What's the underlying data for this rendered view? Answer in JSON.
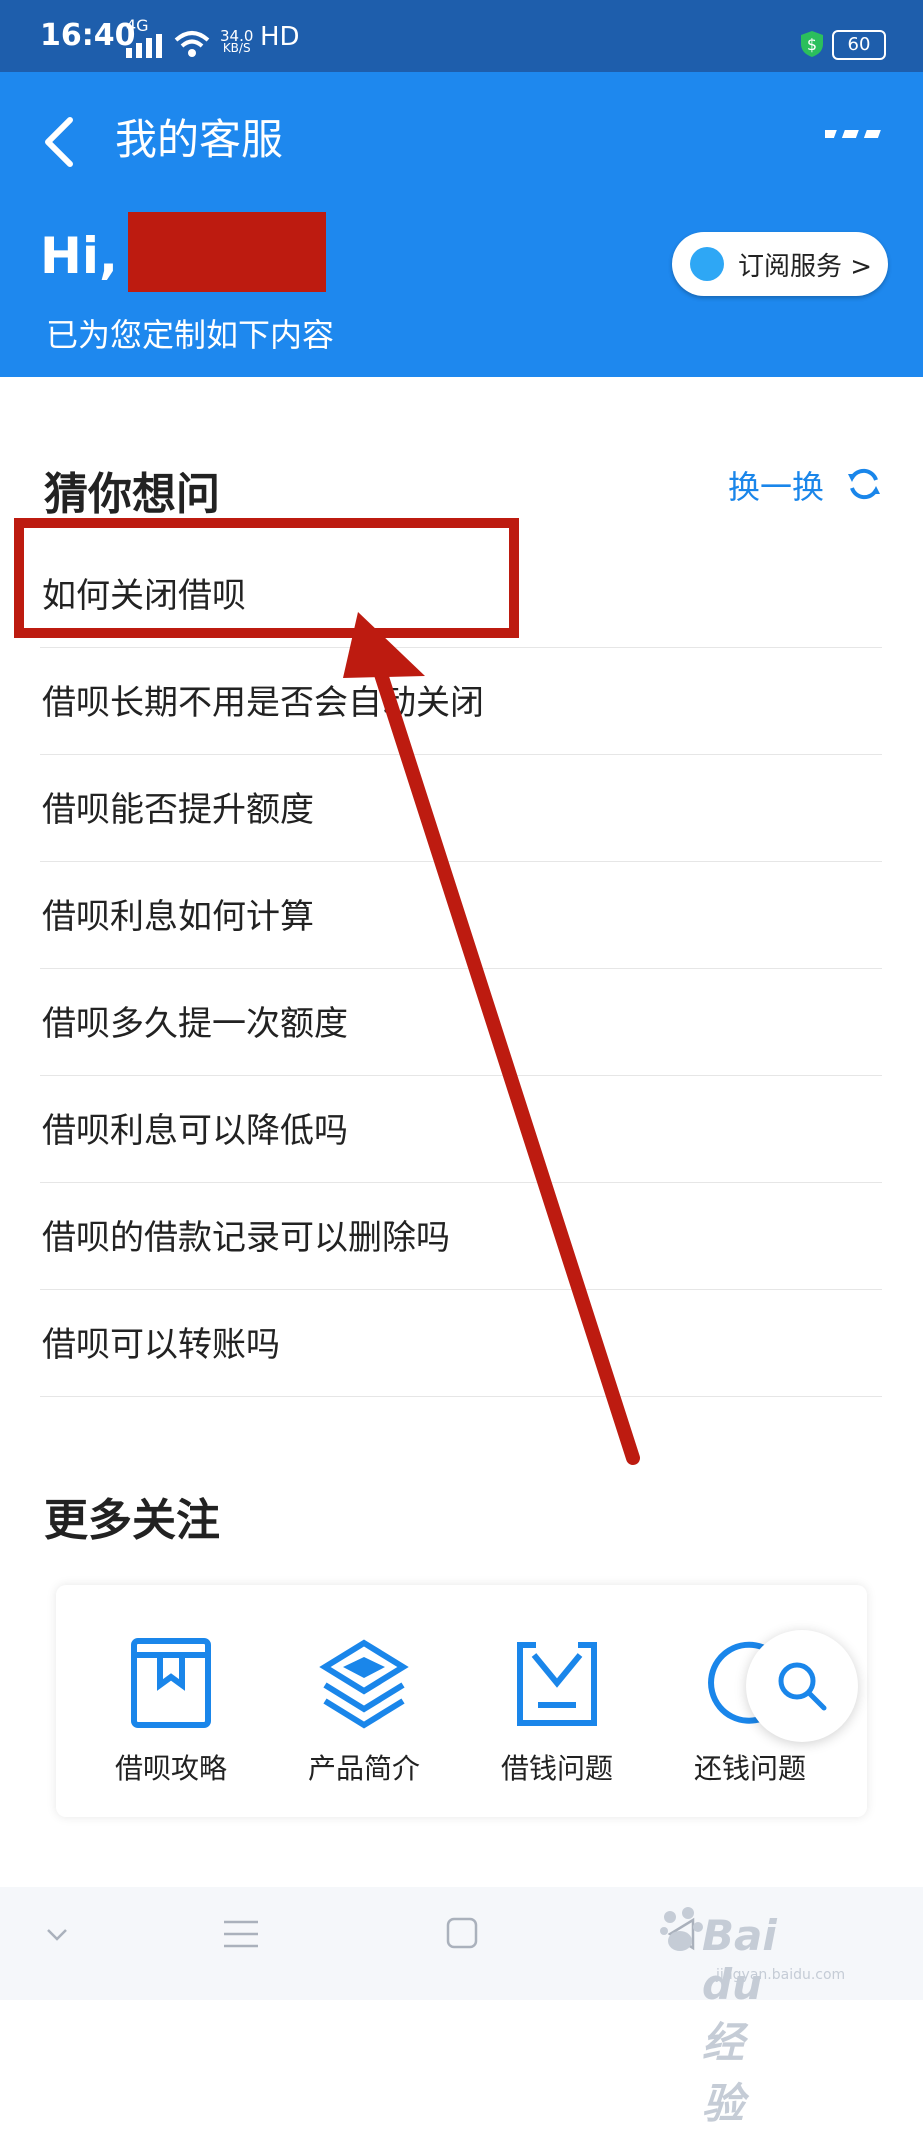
{
  "status_bar": {
    "time": "16:40",
    "network": "4G",
    "speed_value": "34.0",
    "speed_unit": "KB/S",
    "hd": "HD",
    "battery": "60"
  },
  "header": {
    "title": "我的客服",
    "greeting": "Hi,",
    "subtitle": "已为您定制如下内容",
    "subscribe_label": "订阅服务 >",
    "back_icon": "chevron-left-icon",
    "more_icon": "more-dots-icon"
  },
  "guess": {
    "title": "猜你想问",
    "refresh_label": "换一换",
    "items": [
      "如何关闭借呗",
      "借呗长期不用是否会自动关闭",
      "借呗能否提升额度",
      "借呗利息如何计算",
      "借呗多久提一次额度",
      "借呗利息可以降低吗",
      "借呗的借款记录可以删除吗",
      "借呗可以转账吗"
    ]
  },
  "more": {
    "title": "更多关注",
    "tiles": [
      {
        "label": "借呗攻略",
        "icon": "bookmark-book-icon"
      },
      {
        "label": "产品简介",
        "icon": "layers-icon"
      },
      {
        "label": "借钱问题",
        "icon": "inbox-icon"
      },
      {
        "label": "还钱问题",
        "icon": "refund-icon"
      }
    ]
  },
  "watermark": {
    "brand": "Bai du 经验",
    "url": "jingyan.baidu.com"
  },
  "colors": {
    "header_blue": "#1e88ee",
    "statusbar_blue": "#1e5eac",
    "accent": "#1a86ea",
    "annotation_red": "#bd1b10"
  }
}
